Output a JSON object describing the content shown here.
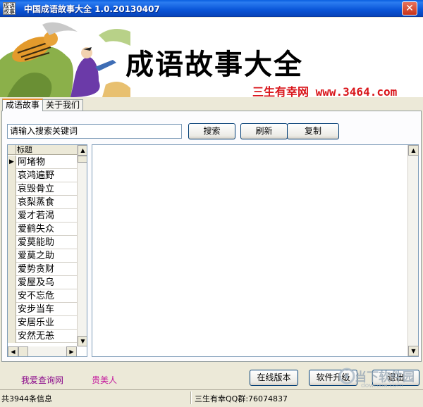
{
  "window": {
    "title": "中国成语故事大全 1.0.20130407",
    "icon_text": "成语\n故事",
    "close_label": "✕"
  },
  "banner": {
    "title": "成语故事大全",
    "subtitle": "三生有幸网 www.3464.com"
  },
  "tabs": [
    {
      "label": "成语故事"
    },
    {
      "label": "关于我们"
    }
  ],
  "search": {
    "placeholder": "请输入搜索关键词",
    "value": "请输入搜索关键词"
  },
  "toolbar": {
    "search_label": "搜索",
    "refresh_label": "刷新",
    "copy_label": "复制"
  },
  "list": {
    "header": "标题",
    "selected_marker": "▶",
    "items": [
      "阿堵物",
      "哀鸿遍野",
      "哀毁骨立",
      "哀梨蒸食",
      "爱才若渴",
      "爱鹤失众",
      "爱莫能助",
      "爱莫之助",
      "爱势贪财",
      "爱屋及乌",
      "安不忘危",
      "安步当车",
      "安居乐业",
      "安然无恙"
    ]
  },
  "scroll": {
    "up": "▲",
    "down": "▼",
    "left": "◀",
    "right": "▶"
  },
  "content": {
    "text": ""
  },
  "bottom": {
    "link_query": "我爱查询网",
    "link_noble": "贵美人",
    "online_label": "在线版本",
    "upgrade_label": "软件升级",
    "exit_label": "退出"
  },
  "status": {
    "count": "共3944条信息",
    "qq": "三生有幸QQ群:76074837"
  },
  "watermark": {
    "text": "当下软件园",
    "url": "downxia.com"
  },
  "colors": {
    "title_bar": "#0a56d8",
    "accent_red": "#d9151a",
    "link_purple": "#8b0a8b",
    "link_pink": "#c4159c",
    "tab_accent": "#e68b2c"
  }
}
